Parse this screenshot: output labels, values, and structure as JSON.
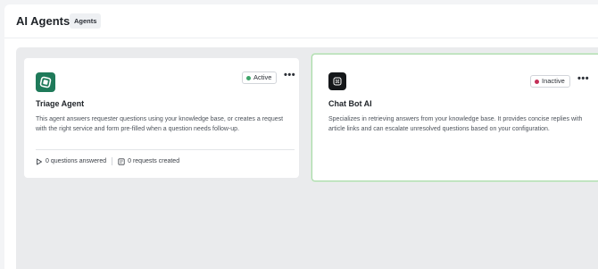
{
  "header": {
    "title": "AI Agents",
    "tag": "Agents"
  },
  "agents": [
    {
      "name": "Triage Agent",
      "status": "Active",
      "status_color": "#3ea56a",
      "logo_color": "#1f7a5a",
      "logo_icon": "triage-agent-logo",
      "description": "This agent answers requester questions using your knowledge base, or creates a request with the right service and form pre-filled when a question needs follow-up.",
      "stats": {
        "questions_answered": "0 questions answered",
        "requests_created": "0 requests created"
      },
      "selected": false
    },
    {
      "name": "Chat Bot AI",
      "status": "Inactive",
      "status_color": "#c43058",
      "logo_color": "#15171a",
      "logo_icon": "chat-bot-logo",
      "description": "Specializes in retrieving answers from your knowledge base. It provides concise replies with article links and can escalate unresolved questions based on your configuration.",
      "selected": true,
      "selected_border_color": "#a7d8a7"
    }
  ],
  "more_label": "•••"
}
